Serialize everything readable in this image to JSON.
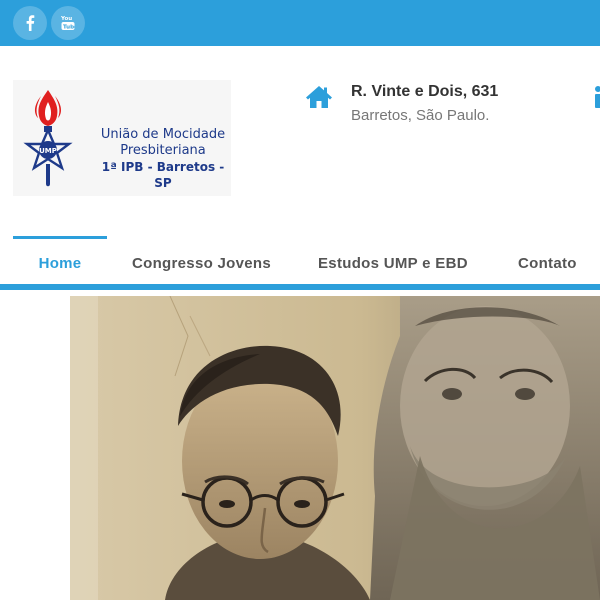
{
  "social": {
    "facebook_icon": "facebook-icon",
    "youtube_icon": "youtube-icon"
  },
  "logo": {
    "line1": "União de Mocidade",
    "line2": "Presbiteriana",
    "line3": "1ª IPB - Barretos - SP",
    "emblem_text": "UMP"
  },
  "address": {
    "icon": "home-icon",
    "title": "R. Vinte e Dois, 631",
    "subtitle": "Barretos, São Paulo."
  },
  "nav": {
    "items": [
      {
        "label": "Home",
        "active": true
      },
      {
        "label": "Congresso Jovens"
      },
      {
        "label": "Estudos UMP e EBD"
      },
      {
        "label": "Contato"
      }
    ]
  },
  "colors": {
    "accent": "#2c9fdb",
    "logo_text": "#1e3a8a",
    "flame": "#e02020"
  }
}
